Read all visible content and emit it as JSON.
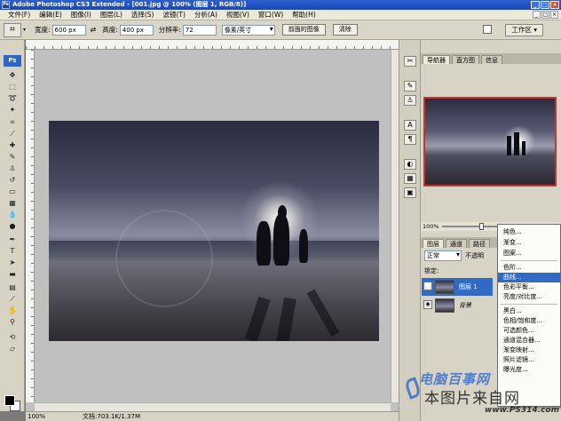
{
  "window": {
    "title": "Adobe Photoshop CS3 Extended - [001.jpg @ 100% (图层 1, RGB/8)]",
    "app_badge": "Ps",
    "min": "_",
    "max": "□",
    "close": "×"
  },
  "menu": {
    "items": [
      "文件(F)",
      "编辑(E)",
      "图像(I)",
      "图层(L)",
      "选择(S)",
      "滤镜(T)",
      "分析(A)",
      "视图(V)",
      "窗口(W)",
      "帮助(H)"
    ]
  },
  "options": {
    "width_label": "宽度:",
    "width_value": "600 px",
    "height_label": "高度:",
    "height_value": "400 px",
    "resolution_label": "分辨率:",
    "resolution_value": "72",
    "unit_value": "像素/英寸",
    "front_image_btn": "前面的图像",
    "clear_btn": "清除",
    "workspace_label": "工作区 ▾"
  },
  "toolbox": {
    "logo": "Ps"
  },
  "status": {
    "zoom": "100%",
    "doc": "文档:703.1K/1.37M"
  },
  "panels": {
    "top_tabs": [
      "导航器",
      "直方图",
      "信息"
    ],
    "zoom_value": "100%",
    "layer_tabs": [
      "图层",
      "通道",
      "路径"
    ],
    "blend_mode": "正常",
    "opacity_label": "不透明",
    "lock_label": "锁定:",
    "layers": [
      {
        "name": "图层 1",
        "selected": true
      },
      {
        "name": "背景",
        "selected": false
      }
    ]
  },
  "context_menu": {
    "items": [
      "纯色...",
      "渐变...",
      "图案...",
      "色阶...",
      "曲线...",
      "色彩平衡...",
      "亮度/对比度...",
      "黑白...",
      "色相/饱和度...",
      "可选颜色...",
      "通道混合器...",
      "渐变映射...",
      "照片滤镜...",
      "曝光度..."
    ],
    "highlighted": "曲线..."
  },
  "watermark": {
    "line1": "电脑百事网",
    "line2": "本图片来自网",
    "line3": "www.PS314.com"
  }
}
